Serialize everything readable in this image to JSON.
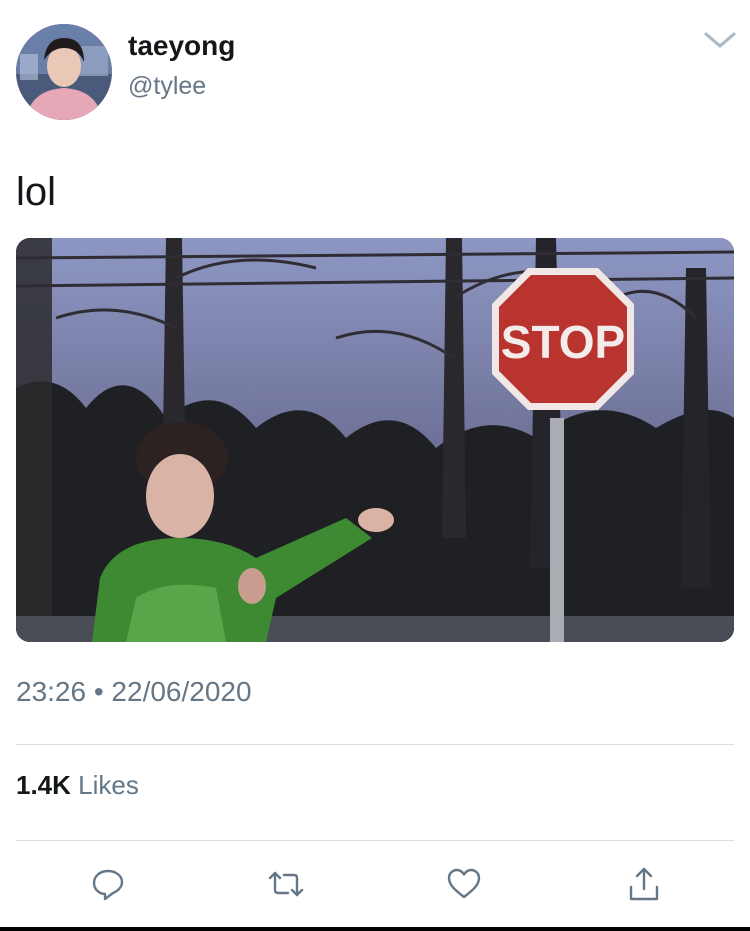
{
  "user": {
    "display_name": "taeyong",
    "handle": "@tylee"
  },
  "tweet": {
    "text": "lol",
    "media_sign_text": "STOP",
    "timestamp": "23:26 • 22/06/2020"
  },
  "stats": {
    "likes_count": "1.4K",
    "likes_label": "Likes"
  },
  "icons": {
    "more": "chevron-down-icon",
    "reply": "reply-icon",
    "retweet": "retweet-icon",
    "like": "heart-icon",
    "share": "share-icon"
  },
  "colors": {
    "text_primary": "#14171a",
    "text_secondary": "#657786",
    "icon": "#657786",
    "divider": "#d8dee3"
  }
}
